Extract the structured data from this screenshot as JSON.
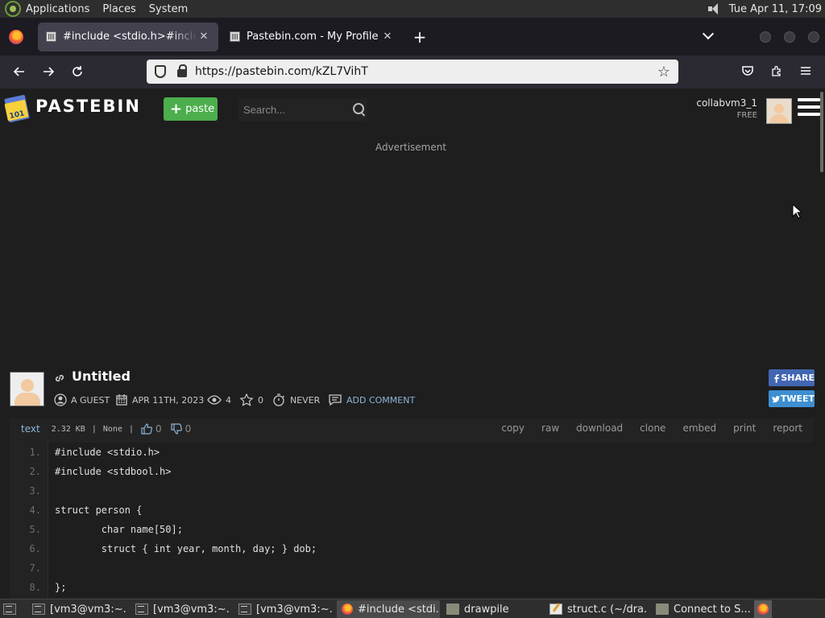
{
  "top_panel": {
    "menus": [
      "Applications",
      "Places",
      "System"
    ],
    "clock": "Tue Apr 11, 17:09"
  },
  "browser": {
    "tabs": [
      {
        "title": "#include <stdio.h>#include <stdbool.h>",
        "active": true
      },
      {
        "title": "Pastebin.com - My Profile",
        "active": false
      }
    ],
    "url": "https://pastebin.com/kZL7VihT"
  },
  "pastebin": {
    "logo_text": "PASTEBIN",
    "paste_button": "paste",
    "search_placeholder": "Search...",
    "username": "collabvm3_1",
    "plan": "FREE",
    "ad_label": "Advertisement",
    "paste": {
      "title": "Untitled",
      "author": "A GUEST",
      "date": "APR 11TH, 2023",
      "views": "4",
      "stars": "0",
      "expires": "NEVER",
      "add_comment": "ADD COMMENT",
      "share": "SHARE",
      "tweet": "TWEET",
      "syntax": "text",
      "size": "2.32 KB",
      "category": "None",
      "likes": "0",
      "dislikes": "0",
      "actions": [
        "copy",
        "raw",
        "download",
        "clone",
        "embed",
        "print",
        "report"
      ],
      "lines": [
        {
          "n": "1.",
          "code": "#include <stdio.h>"
        },
        {
          "n": "2.",
          "code": "#include <stdbool.h>"
        },
        {
          "n": "3.",
          "code": ""
        },
        {
          "n": "4.",
          "code": "struct person {"
        },
        {
          "n": "5.",
          "code": "        char name[50];"
        },
        {
          "n": "6.",
          "code": "        struct { int year, month, day; } dob;"
        },
        {
          "n": "7.",
          "code": ""
        },
        {
          "n": "8.",
          "code": "};"
        }
      ]
    }
  },
  "taskbar": {
    "items": [
      {
        "label": "[vm3@vm3:~...",
        "icon": "terminal-icon"
      },
      {
        "label": "[vm3@vm3:~...",
        "icon": "terminal-icon"
      },
      {
        "label": "[vm3@vm3:~...",
        "icon": "terminal-icon"
      },
      {
        "label": "#include <stdi...",
        "icon": "firefox-icon"
      },
      {
        "label": "drawpile",
        "icon": "folder-icon"
      },
      {
        "label": "struct.c (~/dra...",
        "icon": "text-editor-icon"
      },
      {
        "label": "Connect to S...",
        "icon": "folder-icon"
      }
    ]
  }
}
